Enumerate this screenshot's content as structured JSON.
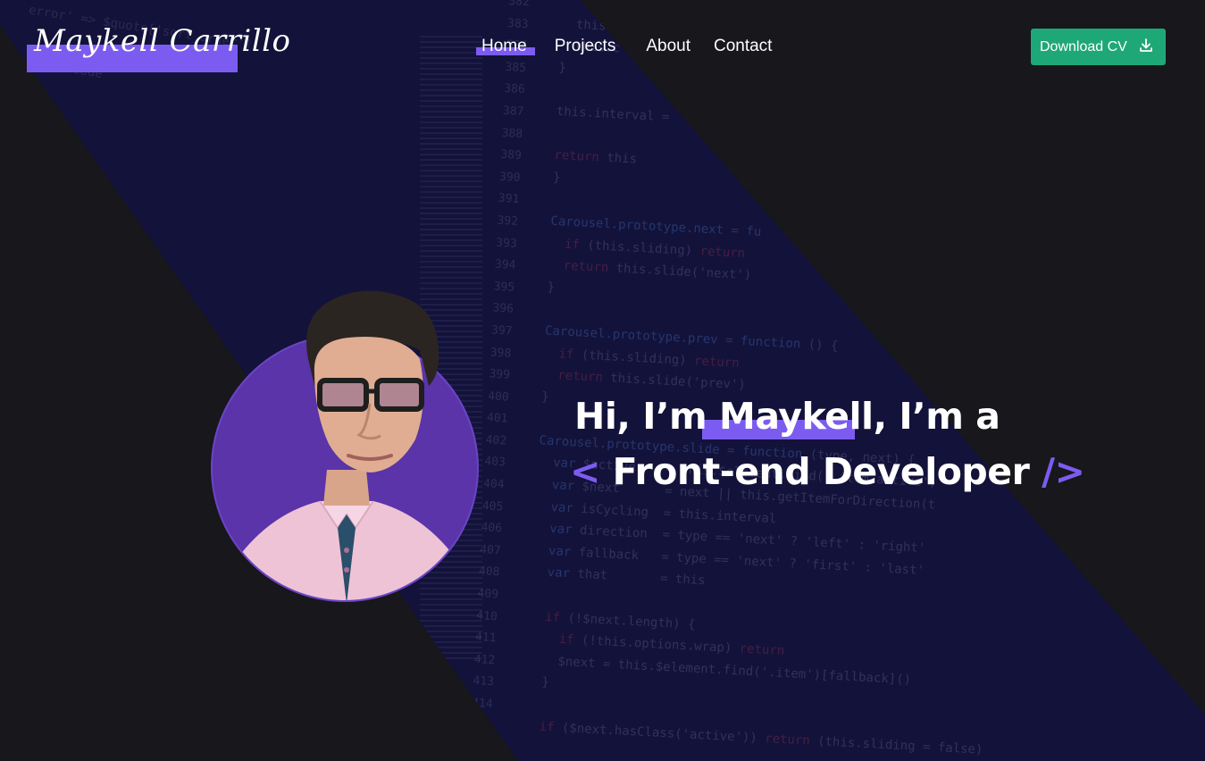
{
  "brand": {
    "name": "Maykell Carrillo"
  },
  "nav": {
    "items": [
      {
        "label": "Home",
        "active": true
      },
      {
        "label": "Projects"
      },
      {
        "label": "About"
      },
      {
        "label": "Contact"
      }
    ]
  },
  "download": {
    "label": "Download CV",
    "icon": "download-icon"
  },
  "hero": {
    "prefix": "Hi, I’m ",
    "name": "Maykell",
    "suffix": ", I’m a",
    "open_tag": "<",
    "role": "Front-end Developer",
    "close_tag": "/>"
  },
  "colors": {
    "accent": "#7c5cf0",
    "button": "#1fa877",
    "background": "#17171c",
    "band": "#13123a"
  }
}
